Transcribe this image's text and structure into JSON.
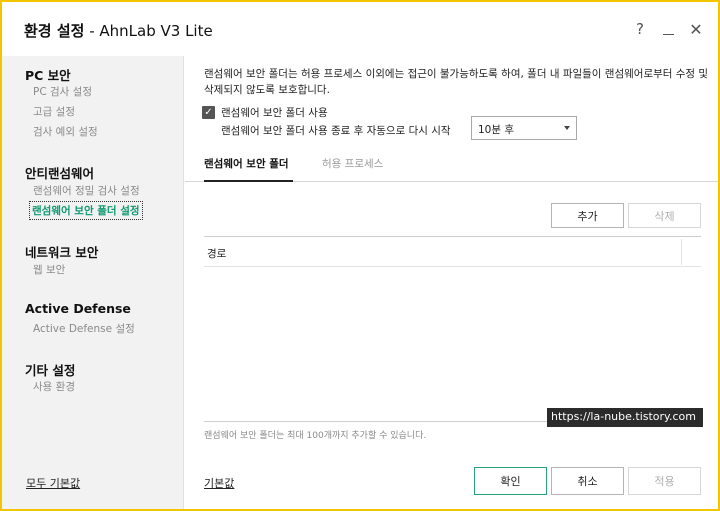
{
  "window": {
    "title_bold": "환경 설정",
    "title_rest": " - AhnLab V3 Lite",
    "help": "?",
    "close": "✕",
    "border_color": "#f5c400"
  },
  "sidebar": {
    "groups": [
      {
        "label": "PC 보안",
        "items": [
          "PC 검사 설정",
          "고급 설정",
          "검사 예외 설정"
        ]
      },
      {
        "label": "안티랜섬웨어",
        "items": [
          "랜섬웨어 정밀 검사 설정",
          "랜섬웨어 보안 폴더 설정"
        ]
      },
      {
        "label": "네트워크 보안",
        "items": [
          "웹 보안"
        ]
      },
      {
        "label": "Active Defense",
        "items": [
          "Active Defense 설정"
        ]
      },
      {
        "label": "기타 설정",
        "items": [
          "사용 환경"
        ]
      }
    ],
    "active_item": "랜섬웨어 보안 폴더 설정",
    "reset_all": "모두 기본값",
    "active_color": "#0f9a6e"
  },
  "content": {
    "description": "랜섬웨어 보안 폴더는 허용 프로세스 이외에는 접근이 불가능하도록 하여, 폴더 내 파일들이 랜섬웨어로부터 수정 및 삭제되지 않도록 보호합니다.",
    "enable_checkbox_label": "랜섬웨어 보안 폴더 사용",
    "enable_checked": true,
    "restart_label": "랜섬웨어 보안 폴더 사용 종료 후 자동으로 다시 시작",
    "restart_value": "10분 후",
    "tabs": [
      "랜섬웨어 보안 폴더",
      "허용 프로세스"
    ],
    "add_button": "추가",
    "delete_button": "삭제",
    "table_header": "경로",
    "note": "랜섬웨어 보안 폴더는 최대 100개까지 추가할 수 있습니다.",
    "watermark": "https://la-nube.tistory.com",
    "default_link": "기본값",
    "ok_button": "확인",
    "cancel_button": "취소",
    "apply_button": "적용"
  }
}
